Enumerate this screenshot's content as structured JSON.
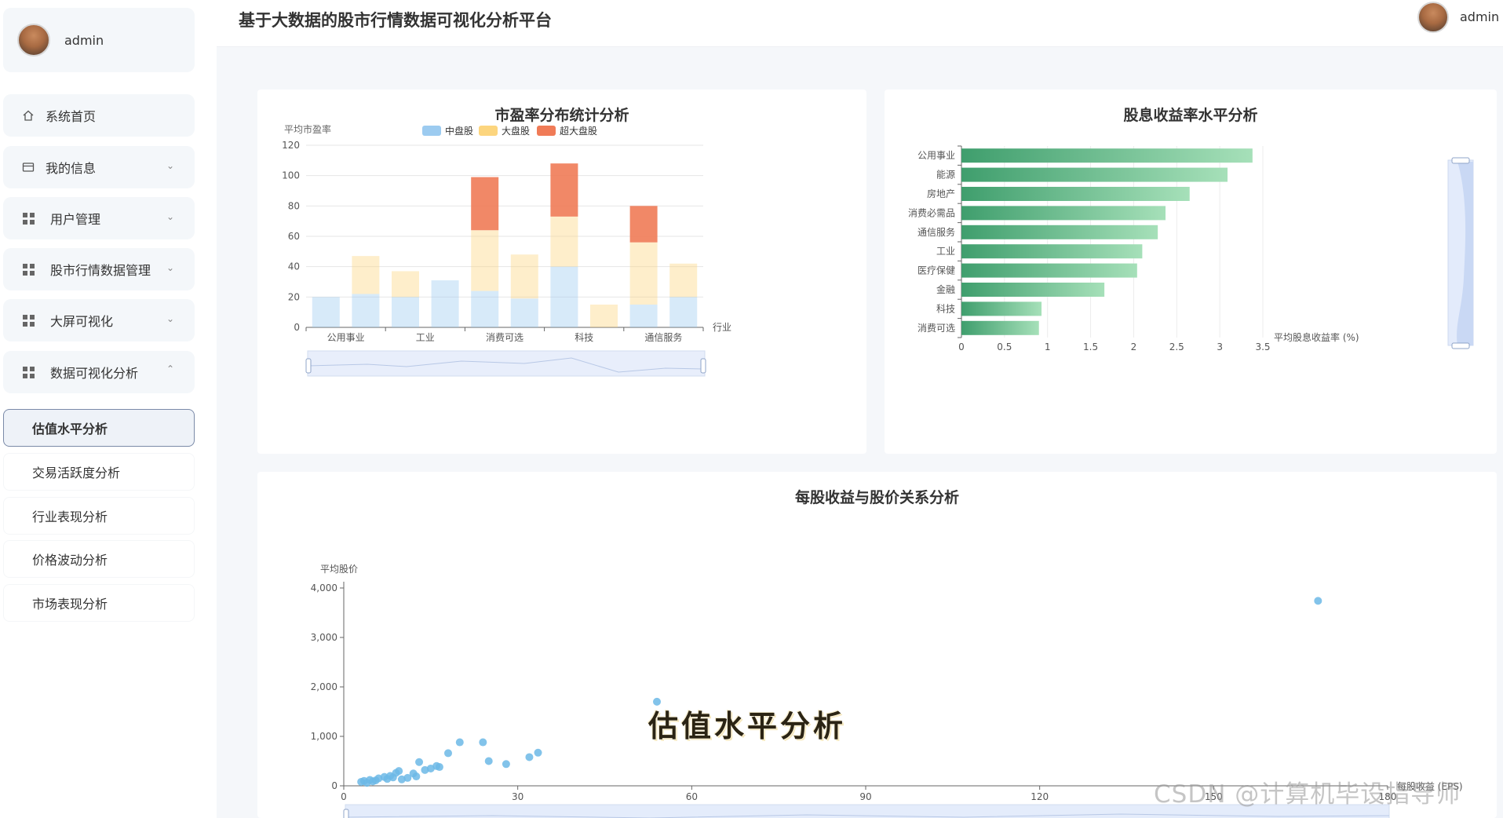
{
  "app": {
    "title": "基于大数据的股市行情数据可视化分析平台",
    "user": "admin"
  },
  "sidebar": {
    "user_name": "admin",
    "menu": [
      {
        "label": "系统首页",
        "icon": "home-icon"
      },
      {
        "label": "我的信息",
        "icon": "id-card-icon"
      },
      {
        "label": "用户管理",
        "icon": "grid-icon"
      },
      {
        "label": "股市行情数据管理",
        "icon": "grid-icon"
      },
      {
        "label": "大屏可视化",
        "icon": "grid-icon"
      },
      {
        "label": "数据可视化分析",
        "icon": "grid-icon"
      }
    ],
    "submenu": [
      {
        "label": "估值水平分析",
        "active": true
      },
      {
        "label": "交易活跃度分析",
        "active": false
      },
      {
        "label": "行业表现分析",
        "active": false
      },
      {
        "label": "价格波动分析",
        "active": false
      },
      {
        "label": "市场表现分析",
        "active": false
      }
    ]
  },
  "overlay": {
    "caption": "估值水平分析",
    "watermark": "CSDN @计算机毕设指导师"
  },
  "chart_data": [
    {
      "type": "bar",
      "stacked": true,
      "title": "市盈率分布统计分析",
      "ylabel": "平均市盈率",
      "xlabel": "行业",
      "ylim": [
        0,
        120
      ],
      "yticks": [
        0,
        20,
        40,
        60,
        80,
        100,
        120
      ],
      "categories": [
        "公用事业",
        "",
        "工业",
        "",
        "消费可选",
        "",
        "科技",
        "",
        "通信服务",
        ""
      ],
      "x_tick_labels": [
        "公用事业",
        "工业",
        "消费可选",
        "科技",
        "通信服务"
      ],
      "legend": {
        "position": "top",
        "entries": [
          "中盘股",
          "大盘股",
          "超大盘股"
        ]
      },
      "colors": {
        "中盘股": "#9ccbf0",
        "大盘股": "#fcd57e",
        "超大盘股": "#f07b57"
      },
      "series": [
        {
          "name": "中盘股",
          "values": [
            20,
            22,
            20,
            31,
            24,
            19,
            40,
            0,
            15,
            20
          ]
        },
        {
          "name": "大盘股",
          "values": [
            0,
            25,
            17,
            0,
            40,
            29,
            33,
            15,
            41,
            22
          ]
        },
        {
          "name": "超大盘股",
          "values": [
            0,
            0,
            0,
            0,
            35,
            0,
            35,
            0,
            24,
            0
          ]
        }
      ],
      "grid": true,
      "zoom_slider": true
    },
    {
      "type": "bar",
      "orientation": "horizontal",
      "title": "股息收益率水平分析",
      "xlabel": "平均股息收益率 (%)",
      "xlim": [
        0,
        3.5
      ],
      "xticks": [
        0,
        0.5,
        1,
        1.5,
        2,
        2.5,
        3,
        3.5
      ],
      "categories": [
        "公用事业",
        "能源",
        "房地产",
        "消费必需品",
        "通信服务",
        "工业",
        "医疗保健",
        "金融",
        "科技",
        "消费可选"
      ],
      "values": [
        3.38,
        3.09,
        2.65,
        2.37,
        2.28,
        2.1,
        2.04,
        1.66,
        0.93,
        0.9
      ],
      "color": "#4caa78",
      "grid": true,
      "zoom_slider": true
    },
    {
      "type": "scatter",
      "title": "每股收益与股价关系分析",
      "xlabel": "每股收益 (EPS)",
      "ylabel": "平均股价",
      "xlim": [
        0,
        180
      ],
      "ylim": [
        0,
        4000
      ],
      "xticks": [
        0,
        30,
        60,
        90,
        120,
        150,
        180
      ],
      "yticks": [
        0,
        1000,
        2000,
        3000,
        4000
      ],
      "ytick_labels": [
        "0",
        "1,000",
        "2,000",
        "3,000",
        "4,000"
      ],
      "color": "#6cb8e6",
      "points": [
        [
          3,
          80
        ],
        [
          3.5,
          100
        ],
        [
          4,
          60
        ],
        [
          4.5,
          120
        ],
        [
          5,
          90
        ],
        [
          5.5,
          110
        ],
        [
          6,
          150
        ],
        [
          7,
          180
        ],
        [
          7.5,
          140
        ],
        [
          8,
          200
        ],
        [
          8.5,
          170
        ],
        [
          9,
          260
        ],
        [
          9.5,
          300
        ],
        [
          10,
          130
        ],
        [
          11,
          160
        ],
        [
          12,
          250
        ],
        [
          12.5,
          190
        ],
        [
          13,
          480
        ],
        [
          14,
          320
        ],
        [
          15,
          350
        ],
        [
          16,
          400
        ],
        [
          16.5,
          380
        ],
        [
          18,
          660
        ],
        [
          20,
          880
        ],
        [
          24,
          880
        ],
        [
          25,
          500
        ],
        [
          28,
          440
        ],
        [
          32,
          580
        ],
        [
          33.5,
          670
        ],
        [
          54,
          1700
        ],
        [
          168,
          3740
        ]
      ],
      "zoom_slider": true
    }
  ]
}
